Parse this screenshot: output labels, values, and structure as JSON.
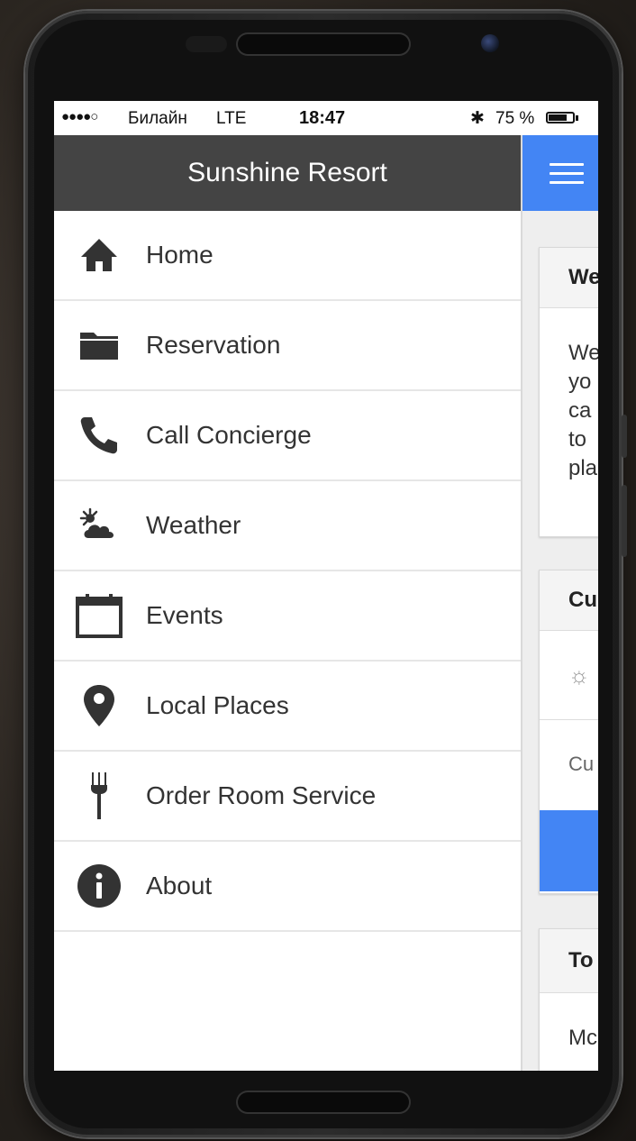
{
  "status_bar": {
    "signal": "●●●●○",
    "carrier": "Билайн",
    "network": "LTE",
    "time": "18:47",
    "bluetooth": "✱",
    "battery_text": "75 %",
    "battery_level": 0.75
  },
  "drawer": {
    "title": "Sunshine Resort",
    "items": [
      {
        "label": "Home",
        "icon": "home-icon"
      },
      {
        "label": "Reservation",
        "icon": "folder-icon"
      },
      {
        "label": "Call Concierge",
        "icon": "phone-icon"
      },
      {
        "label": "Weather",
        "icon": "weather-icon"
      },
      {
        "label": "Events",
        "icon": "calendar-icon"
      },
      {
        "label": "Local Places",
        "icon": "map-pin-icon"
      },
      {
        "label": "Order Room Service",
        "icon": "fork-icon"
      },
      {
        "label": "About",
        "icon": "info-icon"
      }
    ]
  },
  "main": {
    "menu_button_icon": "hamburger-menu-icon",
    "accent_color": "#4385f4",
    "cards": [
      {
        "title": "We",
        "body": "We\nyo\nca\nto\npla"
      },
      {
        "title": "Cu",
        "row1_icon": "sun-icon",
        "row2_text": "Cu"
      },
      {
        "title": "To",
        "body": "Mc"
      }
    ]
  },
  "colors": {
    "drawer_header": "#444444",
    "accent": "#4385f4"
  }
}
